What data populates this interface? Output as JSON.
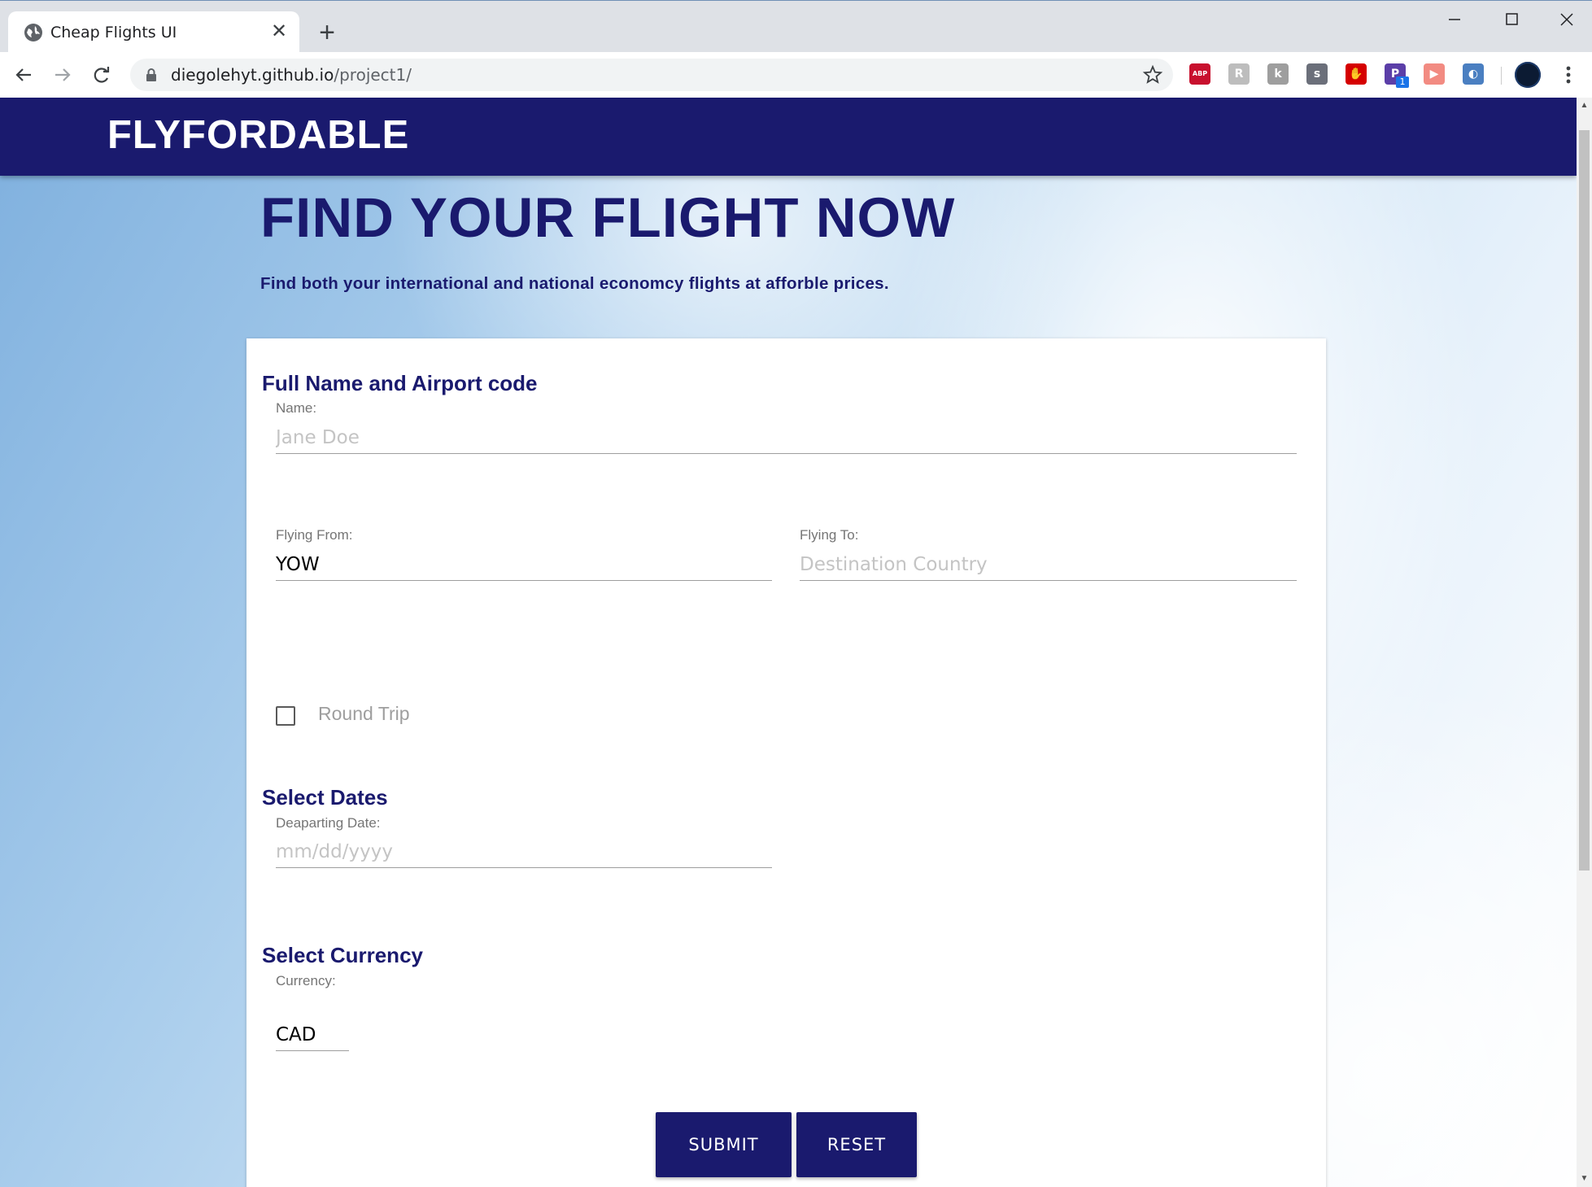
{
  "browser": {
    "tab_title": "Cheap Flights UI",
    "new_tab_symbol": "+",
    "close_symbol": "✕",
    "url_host": "diegolehyt.github.io",
    "url_path": "/project1/",
    "extensions": [
      {
        "icon": "adblock-icon",
        "text": "ABP",
        "color": "#c8102e"
      },
      {
        "icon": "script-r-icon",
        "text": "R",
        "color": "#bdbdbd"
      },
      {
        "icon": "k-extension-icon",
        "text": "k",
        "color": "#9e9e9e"
      },
      {
        "icon": "s-extension-icon",
        "text": "s",
        "color": "#6b6f7a"
      },
      {
        "icon": "stop-hand-icon",
        "text": "✋",
        "color": "#d50000"
      },
      {
        "icon": "p-extension-icon",
        "text": "P",
        "color": "#5b3ea8"
      },
      {
        "icon": "cast-icon",
        "text": "▶",
        "color": "#f28b82"
      },
      {
        "icon": "cloud-sync-icon",
        "text": "◐",
        "color": "#4a7fc1"
      }
    ],
    "p_extension_badge": "1"
  },
  "site": {
    "brand": "FLYFORDABLE",
    "hero_title": "FIND YOUR FLIGHT NOW",
    "hero_subtitle": "Find both your international and national economcy flights at afforble prices."
  },
  "form": {
    "section_name": "Full Name and Airport code",
    "name_label": "Name:",
    "name_placeholder": "Jane Doe",
    "from_label": "Flying From:",
    "from_value": "YOW",
    "to_label": "Flying To:",
    "to_placeholder": "Destination Country",
    "round_trip_label": "Round Trip",
    "round_trip_checked": false,
    "section_dates": "Select Dates",
    "departing_label": "Deaparting Date:",
    "departing_placeholder": "mm/dd/yyyy",
    "section_currency": "Select Currency",
    "currency_label": "Currency:",
    "currency_value": "CAD",
    "submit_label": "SUBMIT",
    "reset_label": "RESET"
  },
  "colors": {
    "brand_navy": "#1a1a6e",
    "label_gray": "#757575"
  }
}
